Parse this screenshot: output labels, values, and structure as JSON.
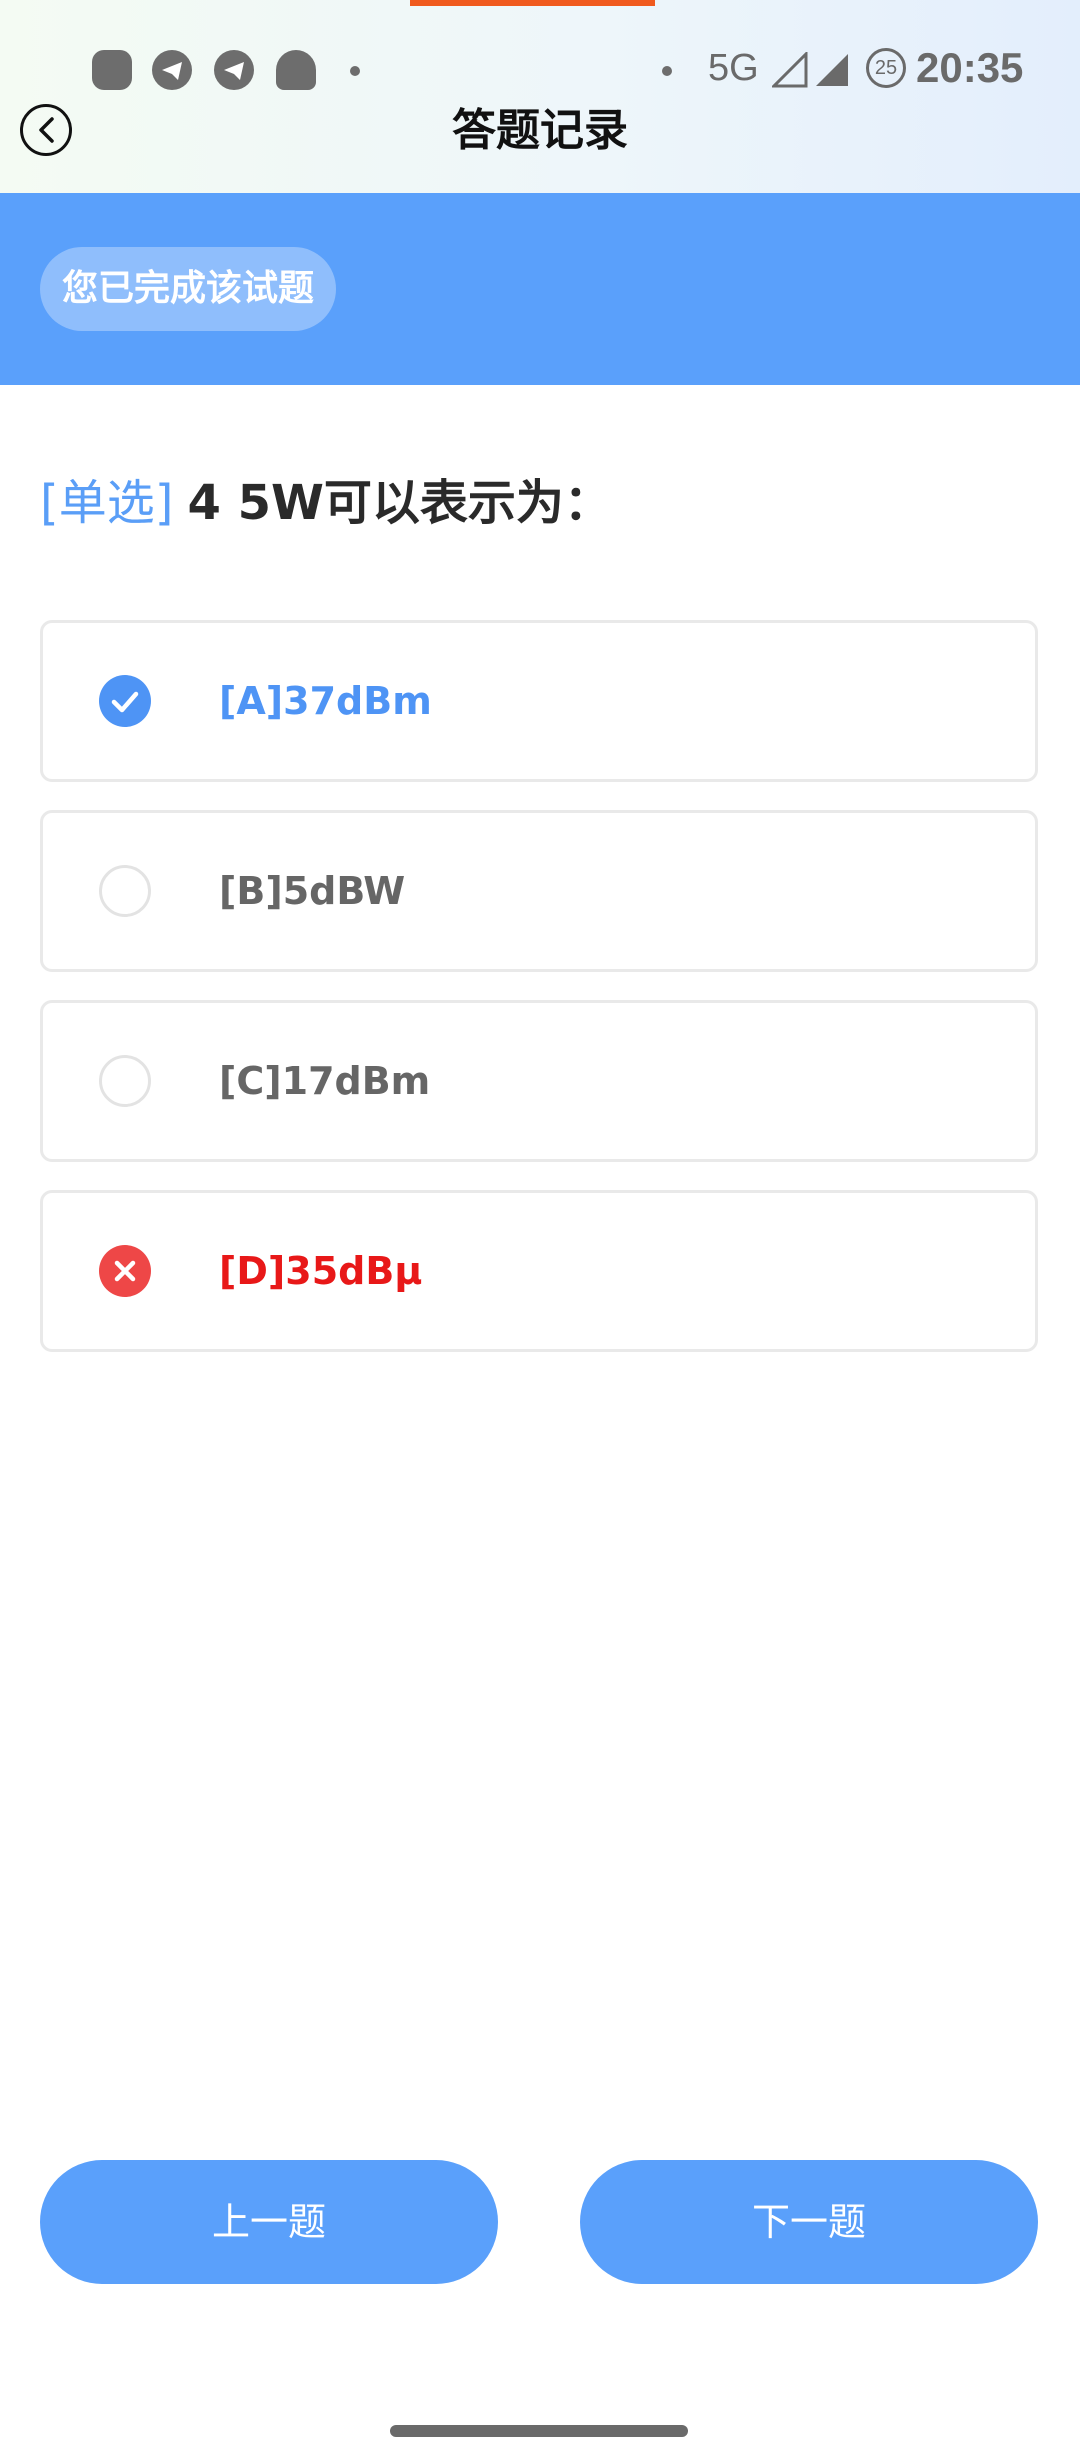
{
  "status_bar": {
    "network": "5G",
    "battery": "25",
    "time": "20:35",
    "app_icons": [
      "cat-app-icon",
      "telegram-icon",
      "telegram-icon",
      "qq-penguin-icon"
    ]
  },
  "header": {
    "title": "答题记录",
    "back_icon": "chevron-left-icon"
  },
  "banner": {
    "status_label": "您已完成该试题"
  },
  "question": {
    "type_label": "[单选]",
    "text": "4 5W可以表示为："
  },
  "options": [
    {
      "label": "[A]37dBm",
      "state": "correct"
    },
    {
      "label": "[B]5dBW",
      "state": "unselected"
    },
    {
      "label": "[C]17dBm",
      "state": "unselected"
    },
    {
      "label": "[D]35dBμ",
      "state": "wrong"
    }
  ],
  "navigation": {
    "prev_label": "上一题",
    "next_label": "下一题"
  },
  "colors": {
    "accent": "#5aa0fb",
    "correct": "#4e94f5",
    "wrong": "#e81818",
    "top_indicator": "#f05a1e"
  }
}
